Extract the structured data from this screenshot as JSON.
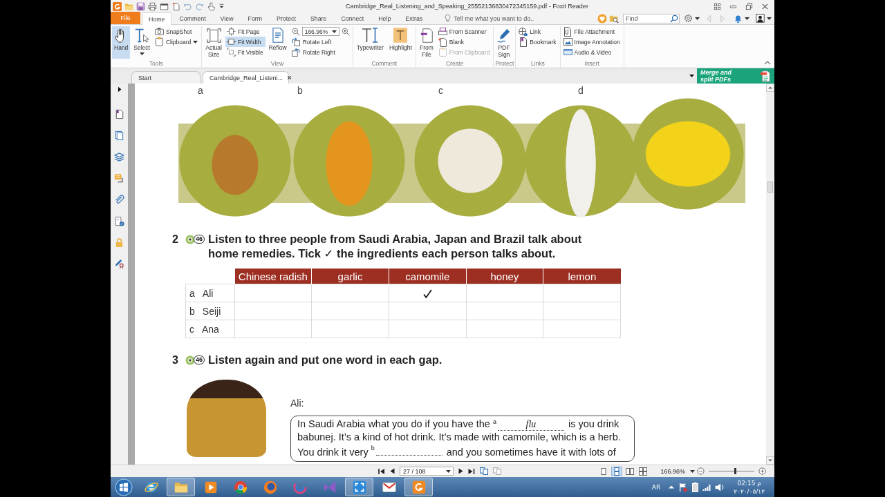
{
  "window": {
    "title": "Cambridge_Real_Listening_and_Speaking_25552136830472345159.pdf - Foxit Reader"
  },
  "menu": {
    "tabs": [
      {
        "label": "File",
        "kind": "file",
        "selected": false
      },
      {
        "label": "Home",
        "kind": "tab",
        "selected": true
      },
      {
        "label": "Comment",
        "kind": "tab",
        "selected": false
      },
      {
        "label": "View",
        "kind": "tab",
        "selected": false
      },
      {
        "label": "Form",
        "kind": "tab",
        "selected": false
      },
      {
        "label": "Protect",
        "kind": "tab",
        "selected": false
      },
      {
        "label": "Share",
        "kind": "tab",
        "selected": false
      },
      {
        "label": "Connect",
        "kind": "tab",
        "selected": false
      },
      {
        "label": "Help",
        "kind": "tab",
        "selected": false
      },
      {
        "label": "Extras",
        "kind": "tab",
        "selected": false
      }
    ],
    "tell_me": {
      "placeholder": "Tell me what you want to do.."
    },
    "find": {
      "placeholder": "Find"
    }
  },
  "ribbon": {
    "groups": [
      {
        "label": "Tools",
        "columns": [
          [
            {
              "label": "Hand",
              "kind": "large",
              "selected": true,
              "disabled": false,
              "dropdown": false
            }
          ],
          [
            {
              "label": "Select",
              "kind": "large",
              "selected": false,
              "disabled": false,
              "dropdown": true
            }
          ],
          [
            {
              "label": "SnapShot",
              "kind": "small",
              "selected": false,
              "disabled": false,
              "dropdown": false
            },
            {
              "label": "Clipboard",
              "kind": "small",
              "selected": false,
              "disabled": false,
              "dropdown": true
            }
          ]
        ]
      },
      {
        "label": "View",
        "columns": [
          [
            {
              "label": "Actual Size",
              "kind": "large",
              "selected": false,
              "disabled": false,
              "dropdown": false
            }
          ],
          [
            {
              "label": "Fit Page",
              "kind": "small",
              "selected": false,
              "disabled": false,
              "dropdown": false
            },
            {
              "label": "Fit Width",
              "kind": "small",
              "selected": true,
              "disabled": false,
              "dropdown": false
            },
            {
              "label": "Fit Visible",
              "kind": "small",
              "selected": false,
              "disabled": false,
              "dropdown": false
            }
          ],
          [
            {
              "label": "Reflow",
              "kind": "large",
              "selected": false,
              "disabled": false,
              "dropdown": false
            }
          ],
          [
            {
              "kind": "zoom",
              "value": "166.96%",
              "selected": false,
              "disabled": false,
              "dropdown": true
            },
            {
              "label": "Rotate Left",
              "kind": "small",
              "selected": false,
              "disabled": false,
              "dropdown": false
            },
            {
              "label": "Rotate Right",
              "kind": "small",
              "selected": false,
              "disabled": false,
              "dropdown": false
            }
          ]
        ]
      },
      {
        "label": "Comment",
        "columns": [
          [
            {
              "label": "Typewriter",
              "kind": "large",
              "selected": false,
              "disabled": false,
              "dropdown": false
            }
          ],
          [
            {
              "label": "Highlight",
              "kind": "large",
              "selected": false,
              "disabled": false,
              "dropdown": false
            }
          ]
        ]
      },
      {
        "label": "Create",
        "columns": [
          [
            {
              "label": "From File",
              "kind": "large",
              "selected": false,
              "disabled": false,
              "dropdown": false
            }
          ],
          [
            {
              "label": "From Scanner",
              "kind": "small",
              "selected": false,
              "disabled": false,
              "dropdown": false
            },
            {
              "label": "Blank",
              "kind": "small",
              "selected": false,
              "disabled": false,
              "dropdown": false
            },
            {
              "label": "From Clipboard",
              "kind": "small",
              "selected": false,
              "disabled": true,
              "dropdown": false
            }
          ]
        ]
      },
      {
        "label": "Protect",
        "columns": [
          [
            {
              "label": "PDF Sign",
              "kind": "large",
              "selected": false,
              "disabled": false,
              "dropdown": false
            }
          ]
        ]
      },
      {
        "label": "Links",
        "columns": [
          [
            {
              "label": "Link",
              "kind": "small",
              "selected": false,
              "disabled": false,
              "dropdown": false
            },
            {
              "label": "Bookmark",
              "kind": "small",
              "selected": false,
              "disabled": false,
              "dropdown": false
            }
          ]
        ]
      },
      {
        "label": "Insert",
        "columns": [
          [
            {
              "label": "File Attachment",
              "kind": "small",
              "selected": false,
              "disabled": false,
              "dropdown": false
            },
            {
              "label": "Image Annotation",
              "kind": "small",
              "selected": false,
              "disabled": false,
              "dropdown": false
            },
            {
              "label": "Audio & Video",
              "kind": "small",
              "selected": false,
              "disabled": false,
              "dropdown": false
            }
          ]
        ]
      }
    ]
  },
  "doc_tabs": [
    {
      "label": "Start",
      "selected": false,
      "closable": false
    },
    {
      "label": "Cambridge_Real_Listeni...",
      "selected": true,
      "closable": true
    }
  ],
  "promo": {
    "text": "Merge and split PDFs"
  },
  "page": {
    "photo_labels": [
      "a",
      "b",
      "c",
      "d"
    ],
    "exercises": [
      {
        "kind": "table",
        "number": "2",
        "track": "46",
        "instruction": "Listen to three people from Saudi Arabia, Japan and Brazil talk about home remedies. Tick ✓ the ingredients each person talks about.",
        "table": {
          "columns": [
            "Chinese radish",
            "garlic",
            "camomile",
            "honey",
            "lemon"
          ],
          "rows": [
            {
              "letter": "a",
              "name": "Ali",
              "cells": [
                {
                  "checked": false
                },
                {
                  "checked": false
                },
                {
                  "checked": true
                },
                {
                  "checked": false
                },
                {
                  "checked": false
                }
              ]
            },
            {
              "letter": "b",
              "name": "Seiji",
              "cells": [
                {
                  "checked": false
                },
                {
                  "checked": false
                },
                {
                  "checked": false
                },
                {
                  "checked": false
                },
                {
                  "checked": false
                }
              ]
            },
            {
              "letter": "c",
              "name": "Ana",
              "cells": [
                {
                  "checked": false
                },
                {
                  "checked": false
                },
                {
                  "checked": false
                },
                {
                  "checked": false
                },
                {
                  "checked": false
                }
              ]
            }
          ]
        }
      },
      {
        "kind": "gap_fill",
        "number": "3",
        "track": "46",
        "instruction": "Listen again and put one word in each gap.",
        "speaker": "Ali:",
        "lines": [
          [
            {
              "kind": "text",
              "text": "In Saudi Arabia what you do if you have the"
            },
            {
              "kind": "gap",
              "label": "a",
              "value": "flu"
            },
            {
              "kind": "text",
              "text": "is you drink"
            }
          ],
          [
            {
              "kind": "text",
              "text": "babunej. It’s a kind of hot drink. It’s made with camomile, which is a herb."
            }
          ],
          [
            {
              "kind": "text",
              "text": "You drink it very"
            },
            {
              "kind": "gap",
              "label": "b"
            },
            {
              "kind": "text",
              "text": "and you sometimes have it with lots of"
            }
          ]
        ]
      }
    ]
  },
  "status_bar": {
    "page": "27 / 108",
    "view_modes": [
      {
        "selected": false
      },
      {
        "selected": true
      },
      {
        "selected": false
      },
      {
        "selected": false
      }
    ],
    "zoom": "166.96%",
    "zoom_slider": {
      "level": 0.57
    }
  },
  "taskbar": {
    "apps": [
      {
        "active": false
      },
      {
        "active": true
      },
      {
        "active": false
      },
      {
        "active": false
      },
      {
        "active": false
      },
      {
        "active": false
      },
      {
        "active": false
      },
      {
        "active": true
      },
      {
        "active": false
      },
      {
        "active": true
      }
    ],
    "language": "AR",
    "time": "02:15 م",
    "date": "٢٠٢٠/٠٥/١٢"
  }
}
